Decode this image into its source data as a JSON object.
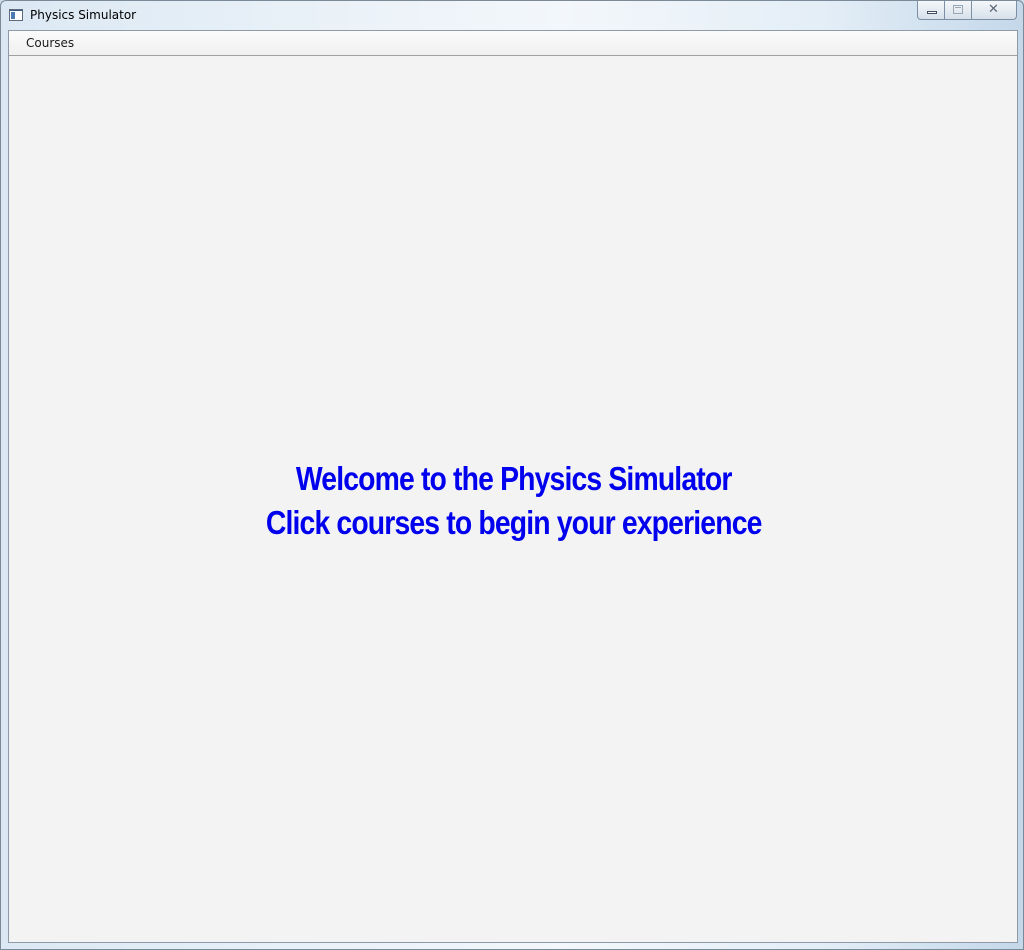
{
  "window": {
    "title": "Physics Simulator",
    "icon": "app-window-icon",
    "caption": {
      "minimize_icon": "minimize-icon",
      "maximize_icon": "maximize-icon",
      "close_icon": "close-icon",
      "close_glyph": "✕"
    }
  },
  "menubar": {
    "items": [
      {
        "label": "Courses"
      }
    ]
  },
  "main": {
    "welcome_line1": "Welcome to the Physics Simulator",
    "welcome_line2": "Click courses to begin your experience",
    "text_color": "#0000ee",
    "background": "#f3f3f3"
  }
}
